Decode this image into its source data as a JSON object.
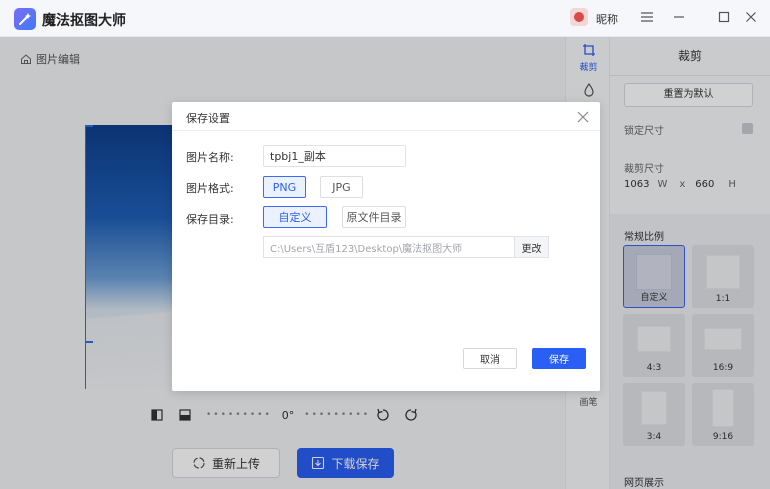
{
  "app": {
    "title": "魔法抠图大师",
    "nickname": "昵称"
  },
  "window_controls": [
    "menu-icon",
    "minimize-icon",
    "maximize-icon",
    "close-icon"
  ],
  "workspace": {
    "breadcrumb": "图片编辑",
    "rotation_value": "0°",
    "reupload_label": "重新上传",
    "download_label": "下载保存"
  },
  "toolstrip": {
    "items": [
      {
        "label": "裁剪",
        "icon": "crop-icon",
        "active": true
      },
      {
        "label": "",
        "icon": "paint-drop-icon",
        "active": false
      },
      {
        "label": "画笔",
        "icon": "brush-icon",
        "active": false
      }
    ]
  },
  "panel": {
    "title": "裁剪",
    "reset_label": "重置为默认",
    "lock_label": "锁定尺寸",
    "size_label": "裁剪尺寸",
    "width": "1063",
    "width_unit": "W",
    "x_sep": "x",
    "height": "660",
    "height_unit": "H",
    "ratio_heading": "常规比例",
    "ratios": [
      "自定义",
      "1:1",
      "4:3",
      "16:9",
      "3:4",
      "9:16"
    ],
    "web_preview": "网页展示"
  },
  "dialog": {
    "title": "保存设置",
    "name_label": "图片名称:",
    "name_value": "tpbj1_副本",
    "format_label": "图片格式:",
    "formats": [
      "PNG",
      "JPG"
    ],
    "selected_format": "PNG",
    "dir_label": "保存目录:",
    "dir_options": [
      "自定义",
      "原文件目录"
    ],
    "selected_dir": "自定义",
    "path_value": "C:\\Users\\互盾123\\Desktop\\魔法抠图大师",
    "change_label": "更改",
    "cancel_label": "取消",
    "save_label": "保存"
  },
  "colors": {
    "accent": "#2a5ff6",
    "title_bar": "#f6f7fa",
    "panel_bg": "#f7f8fa"
  }
}
